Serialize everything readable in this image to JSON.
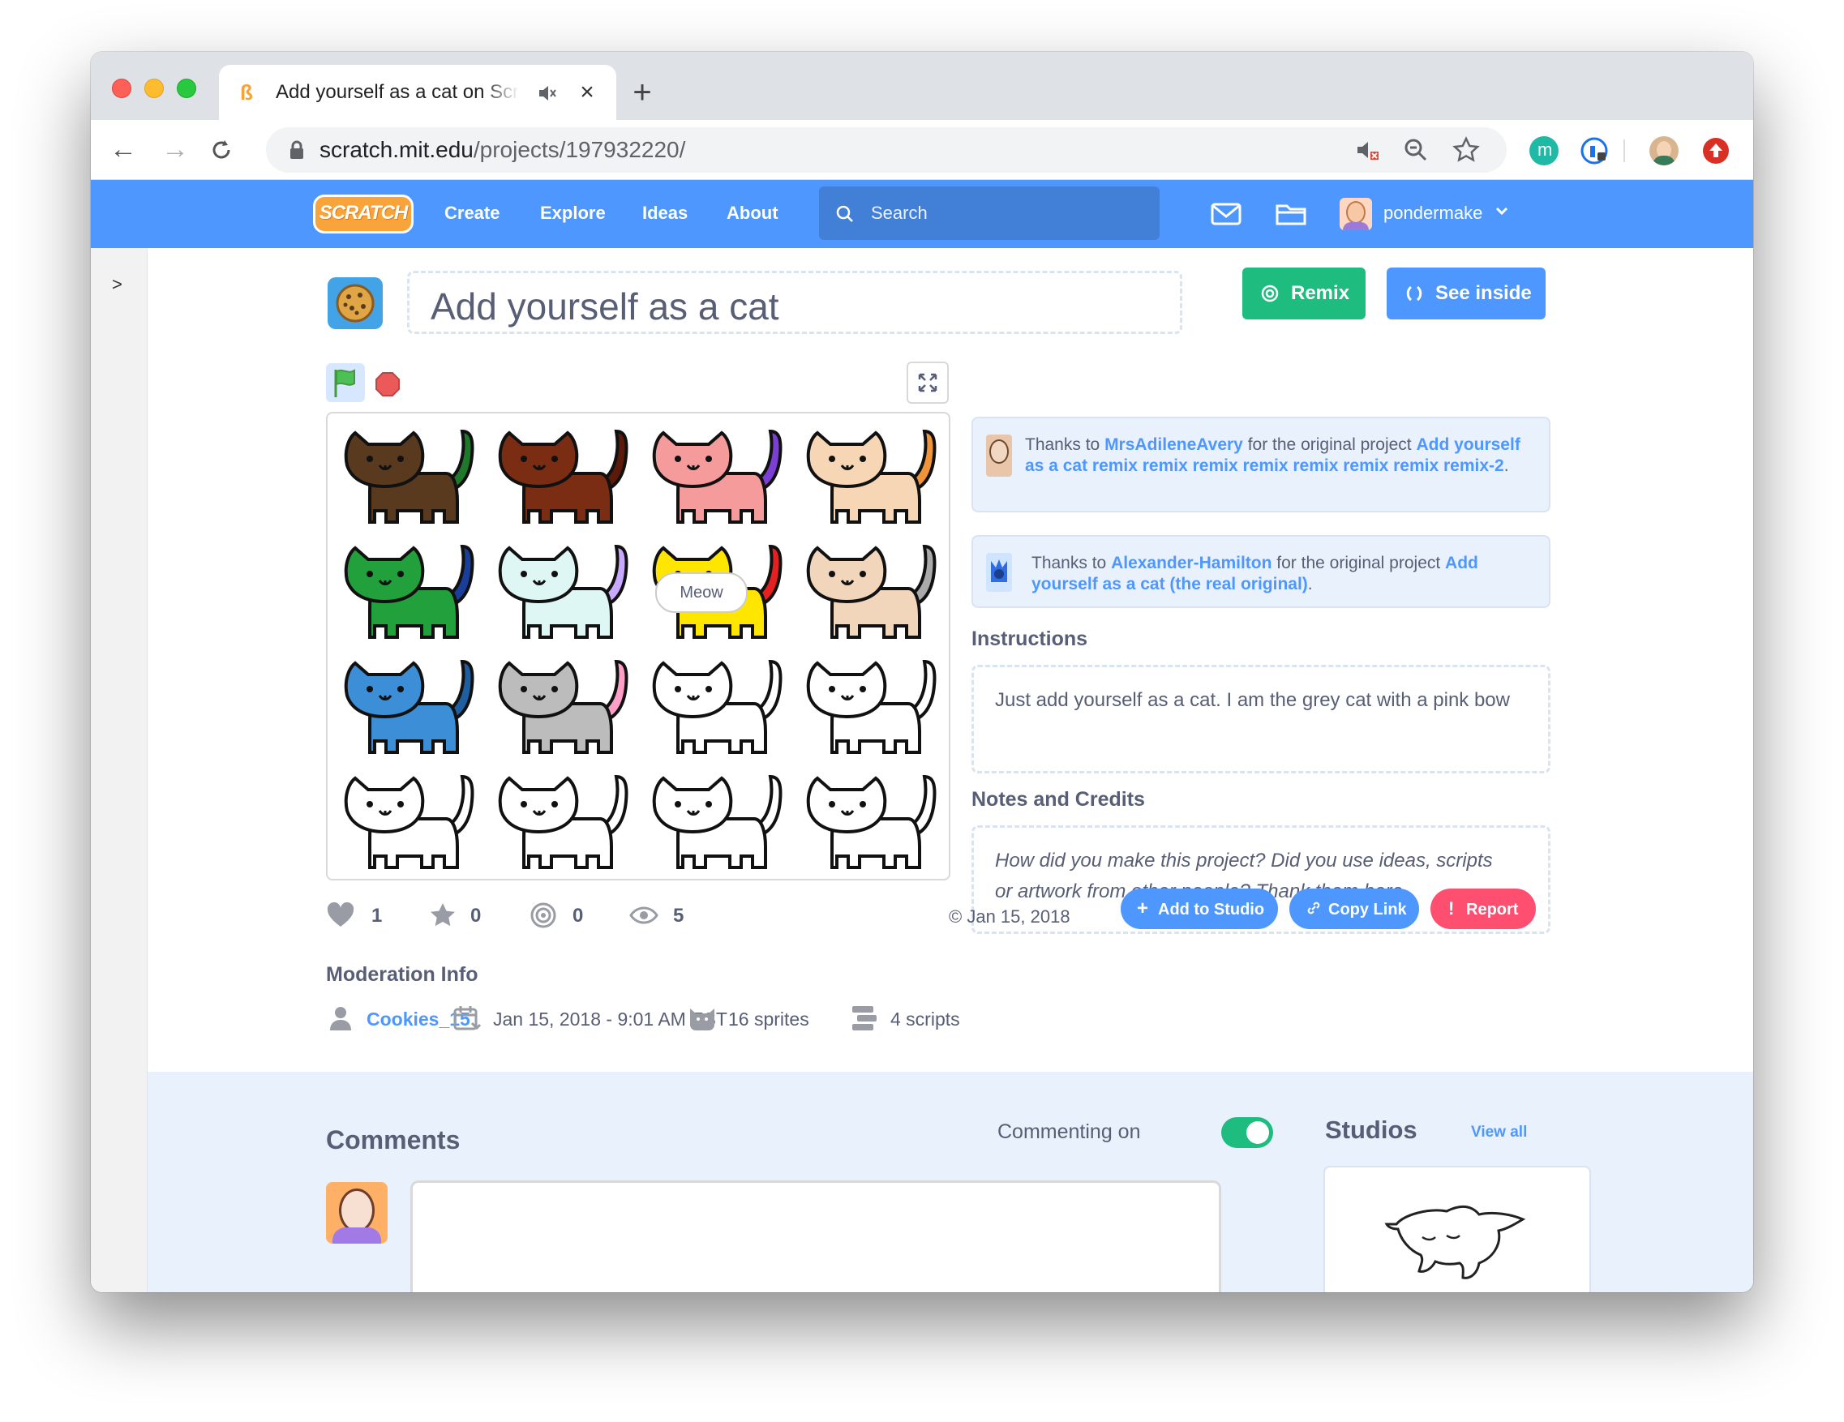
{
  "browser": {
    "tab_title": "Add yourself as a cat on Scratch",
    "url_host": "scratch.mit.edu",
    "url_path": "/projects/197932220/"
  },
  "nav": {
    "links": [
      "Create",
      "Explore",
      "Ideas",
      "About"
    ],
    "search_placeholder": "Search",
    "username": "pondermake",
    "logo_text": "SCRATCH"
  },
  "sidebar": {
    "toggle": ">"
  },
  "project": {
    "title": "Add yourself as a cat",
    "remix_label": "Remix",
    "see_inside_label": "See inside",
    "speech_bubble": "Meow"
  },
  "credits": [
    {
      "prefix": "Thanks to ",
      "author": "MrsAdileneAvery",
      "middle": " for the original project ",
      "project": "Add yourself as a cat remix remix remix remix remix remix remix remix-2",
      "suffix": "."
    },
    {
      "prefix": "Thanks to ",
      "author": "Alexander-Hamilton",
      "middle": " for the original project ",
      "project": "Add yourself as a cat (the real original)",
      "suffix": "."
    }
  ],
  "instructions": {
    "heading": "Instructions",
    "text": "Just add yourself as a cat. I am the grey cat with a pink bow"
  },
  "notes": {
    "heading": "Notes and Credits",
    "placeholder": "How did you make this project? Did you use ideas, scripts or artwork from other people? Thank them here."
  },
  "stats": {
    "loves": "1",
    "favorites": "0",
    "remixes": "0",
    "views": "5",
    "shared_date": "Jan 15, 2018"
  },
  "actions": {
    "add_to_studio": "Add to Studio",
    "copy_link": "Copy Link",
    "report": "Report"
  },
  "moderation": {
    "heading": "Moderation Info",
    "author": "Cookies_15",
    "created": "Jan 15, 2018 - 9:01 AM EST",
    "sprites": "16 sprites",
    "scripts": "4 scripts"
  },
  "comments": {
    "heading": "Comments",
    "commenting_label": "Commenting on"
  },
  "studios": {
    "heading": "Studios",
    "view_all": "View all"
  },
  "colors": {
    "scratch_blue": "#4d97ff",
    "remix_green": "#1fbc7f",
    "report_red": "#ff4f70",
    "text_gray": "#575e75"
  },
  "cats": [
    {
      "body": "#5a3a1e",
      "extra": "#1e7a2a"
    },
    {
      "body": "#7a2d12",
      "extra": "#5b1a0a"
    },
    {
      "body": "#f59b9b",
      "extra": "#7b3fd6"
    },
    {
      "body": "#f7d6b5",
      "extra": "#f0943a"
    },
    {
      "body": "#22a03c",
      "extra": "#1a3f9a"
    },
    {
      "body": "#dff7f4",
      "extra": "#c9a8ff"
    },
    {
      "body": "#ffe600",
      "extra": "#e62020"
    },
    {
      "body": "#f2d6bb",
      "extra": "#aaaaaa"
    },
    {
      "body": "#3c8fd6",
      "extra": "#1d5fa0"
    },
    {
      "body": "#bcbcbc",
      "extra": "#ff9ec7"
    },
    {
      "body": "#ffffff",
      "extra": "#ffffff"
    },
    {
      "body": "#ffffff",
      "extra": "#ffffff"
    },
    {
      "body": "#ffffff",
      "extra": "#ffffff"
    },
    {
      "body": "#ffffff",
      "extra": "#ffffff"
    },
    {
      "body": "#ffffff",
      "extra": "#ffffff"
    },
    {
      "body": "#ffffff",
      "extra": "#ffffff"
    }
  ]
}
